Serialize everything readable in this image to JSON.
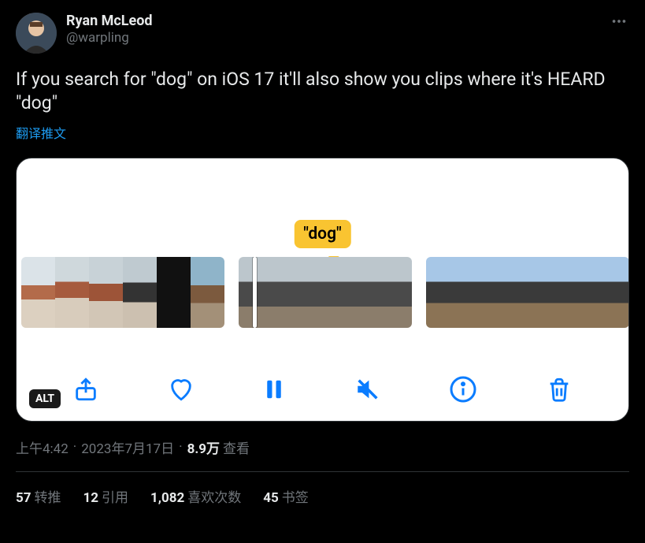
{
  "author": {
    "display_name": "Ryan McLeod",
    "handle": "@warpling"
  },
  "tweet_text": "If you search for \"dog\" on iOS 17 it'll also show you clips where it's HEARD \"dog\"",
  "translate_label": "翻译推文",
  "media": {
    "tooltip_text": "\"dog\"",
    "alt_badge": "ALT"
  },
  "meta": {
    "time": "上午4:42",
    "date": "2023年7月17日",
    "views_count": "8.9万",
    "views_label": "查看"
  },
  "stats": {
    "retweets_count": "57",
    "retweets_label": "转推",
    "quotes_count": "12",
    "quotes_label": "引用",
    "likes_count": "1,082",
    "likes_label": "喜欢次数",
    "bookmarks_count": "45",
    "bookmarks_label": "书签"
  }
}
